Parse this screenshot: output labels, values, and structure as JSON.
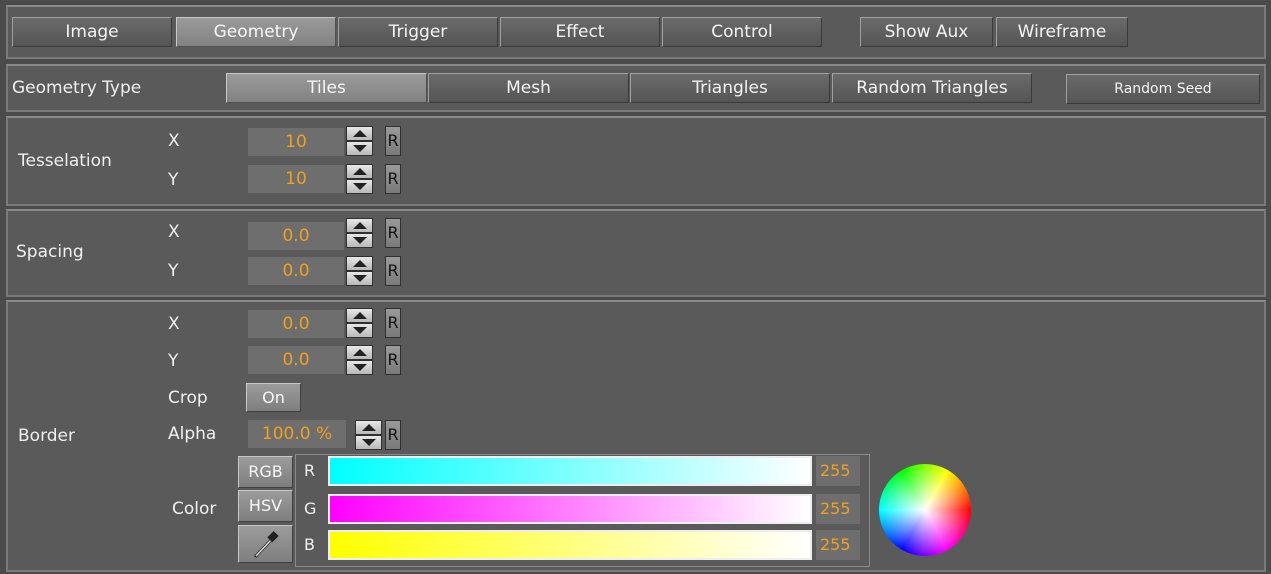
{
  "tabs": {
    "image": "Image",
    "geometry": "Geometry",
    "trigger": "Trigger",
    "effect": "Effect",
    "control": "Control",
    "show_aux": "Show Aux",
    "wireframe": "Wireframe"
  },
  "geometry_type": {
    "label": "Geometry Type",
    "options": [
      "Tiles",
      "Mesh",
      "Triangles",
      "Random Triangles"
    ],
    "selected": "Tiles",
    "random_seed": "Random Seed"
  },
  "tesselation": {
    "label": "Tesselation",
    "x_label": "X",
    "x": "10",
    "y_label": "Y",
    "y": "10"
  },
  "spacing": {
    "label": "Spacing",
    "x_label": "X",
    "x": "0.0",
    "y_label": "Y",
    "y": "0.0"
  },
  "border": {
    "label": "Border",
    "x_label": "X",
    "x": "0.0",
    "y_label": "Y",
    "y": "0.0",
    "crop_label": "Crop",
    "crop_value": "On",
    "alpha_label": "Alpha",
    "alpha": "100.0 %",
    "color_label": "Color",
    "rgb_button": "RGB",
    "hsv_button": "HSV",
    "channels": [
      {
        "name": "R",
        "value": "255",
        "color": "#00ffff"
      },
      {
        "name": "G",
        "value": "255",
        "color": "#ff00ff"
      },
      {
        "name": "B",
        "value": "255",
        "color": "#ffff00"
      }
    ]
  },
  "reset_label": "R",
  "colors": {
    "accent_value": "#f0a020",
    "panel": "#5a5a5a",
    "background": "#4b4b4b"
  },
  "icons": {
    "spinner": "up-down-arrows-icon",
    "eyedropper": "eyedropper-icon",
    "wheel": "color-wheel-icon"
  }
}
